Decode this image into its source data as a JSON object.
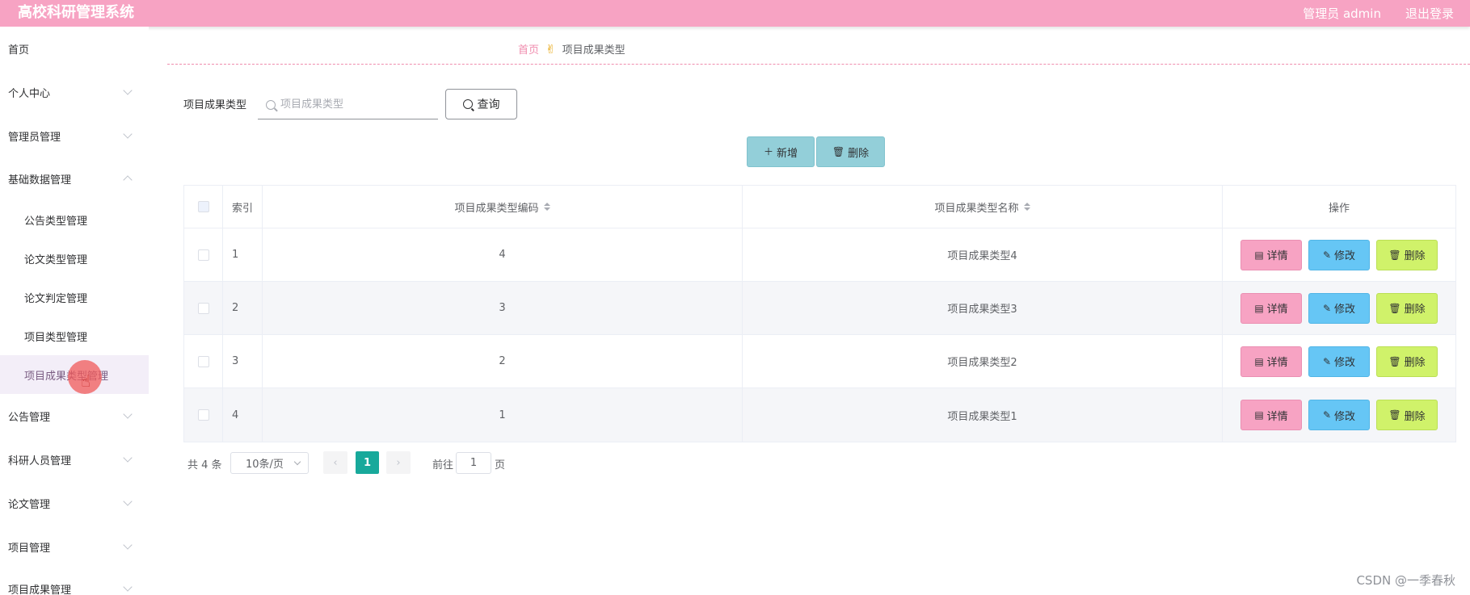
{
  "header": {
    "app_title": "高校科研管理系统",
    "user_label": "管理员 admin",
    "logout_label": "退出登录"
  },
  "sidebar": {
    "items": [
      {
        "label": "首页"
      },
      {
        "label": "个人中心"
      },
      {
        "label": "管理员管理"
      },
      {
        "label": "基础数据管理"
      },
      {
        "label": "公告管理"
      },
      {
        "label": "科研人员管理"
      },
      {
        "label": "论文管理"
      },
      {
        "label": "项目管理"
      },
      {
        "label": "项目成果管理"
      }
    ],
    "sub_items": [
      {
        "label": "公告类型管理"
      },
      {
        "label": "论文类型管理"
      },
      {
        "label": "论文判定管理"
      },
      {
        "label": "项目类型管理"
      },
      {
        "label": "项目成果类型管理"
      }
    ]
  },
  "breadcrumb": {
    "home": "首页",
    "separator_icon": "hand-pointer-icon",
    "current": "项目成果类型"
  },
  "search": {
    "label": "项目成果类型",
    "placeholder": "项目成果类型",
    "value": "",
    "query_label": "查询"
  },
  "actions": {
    "add_label": "新增",
    "delete_label": "删除"
  },
  "table": {
    "headers": {
      "index": "索引",
      "code": "项目成果类型编码",
      "name": "项目成果类型名称",
      "ops": "操作"
    },
    "rows": [
      {
        "index": "1",
        "code": "4",
        "name": "项目成果类型4"
      },
      {
        "index": "2",
        "code": "3",
        "name": "项目成果类型3"
      },
      {
        "index": "3",
        "code": "2",
        "name": "项目成果类型2"
      },
      {
        "index": "4",
        "code": "1",
        "name": "项目成果类型1"
      }
    ],
    "op_labels": {
      "detail": "详情",
      "edit": "修改",
      "delete": "删除"
    }
  },
  "pagination": {
    "total_text": "共 4 条",
    "page_size": "10条/页",
    "current_page": "1",
    "goto_prefix": "前往",
    "goto_value": "1",
    "goto_suffix": "页"
  },
  "watermark": "CSDN @一季春秋",
  "colors": {
    "header": "#f7a3c3",
    "detail_button": "#f7a3c3",
    "edit_button": "#66c6f5",
    "delete_button": "#d0f26a",
    "action_button": "#93cfd9",
    "current_page": "#18a99b"
  }
}
